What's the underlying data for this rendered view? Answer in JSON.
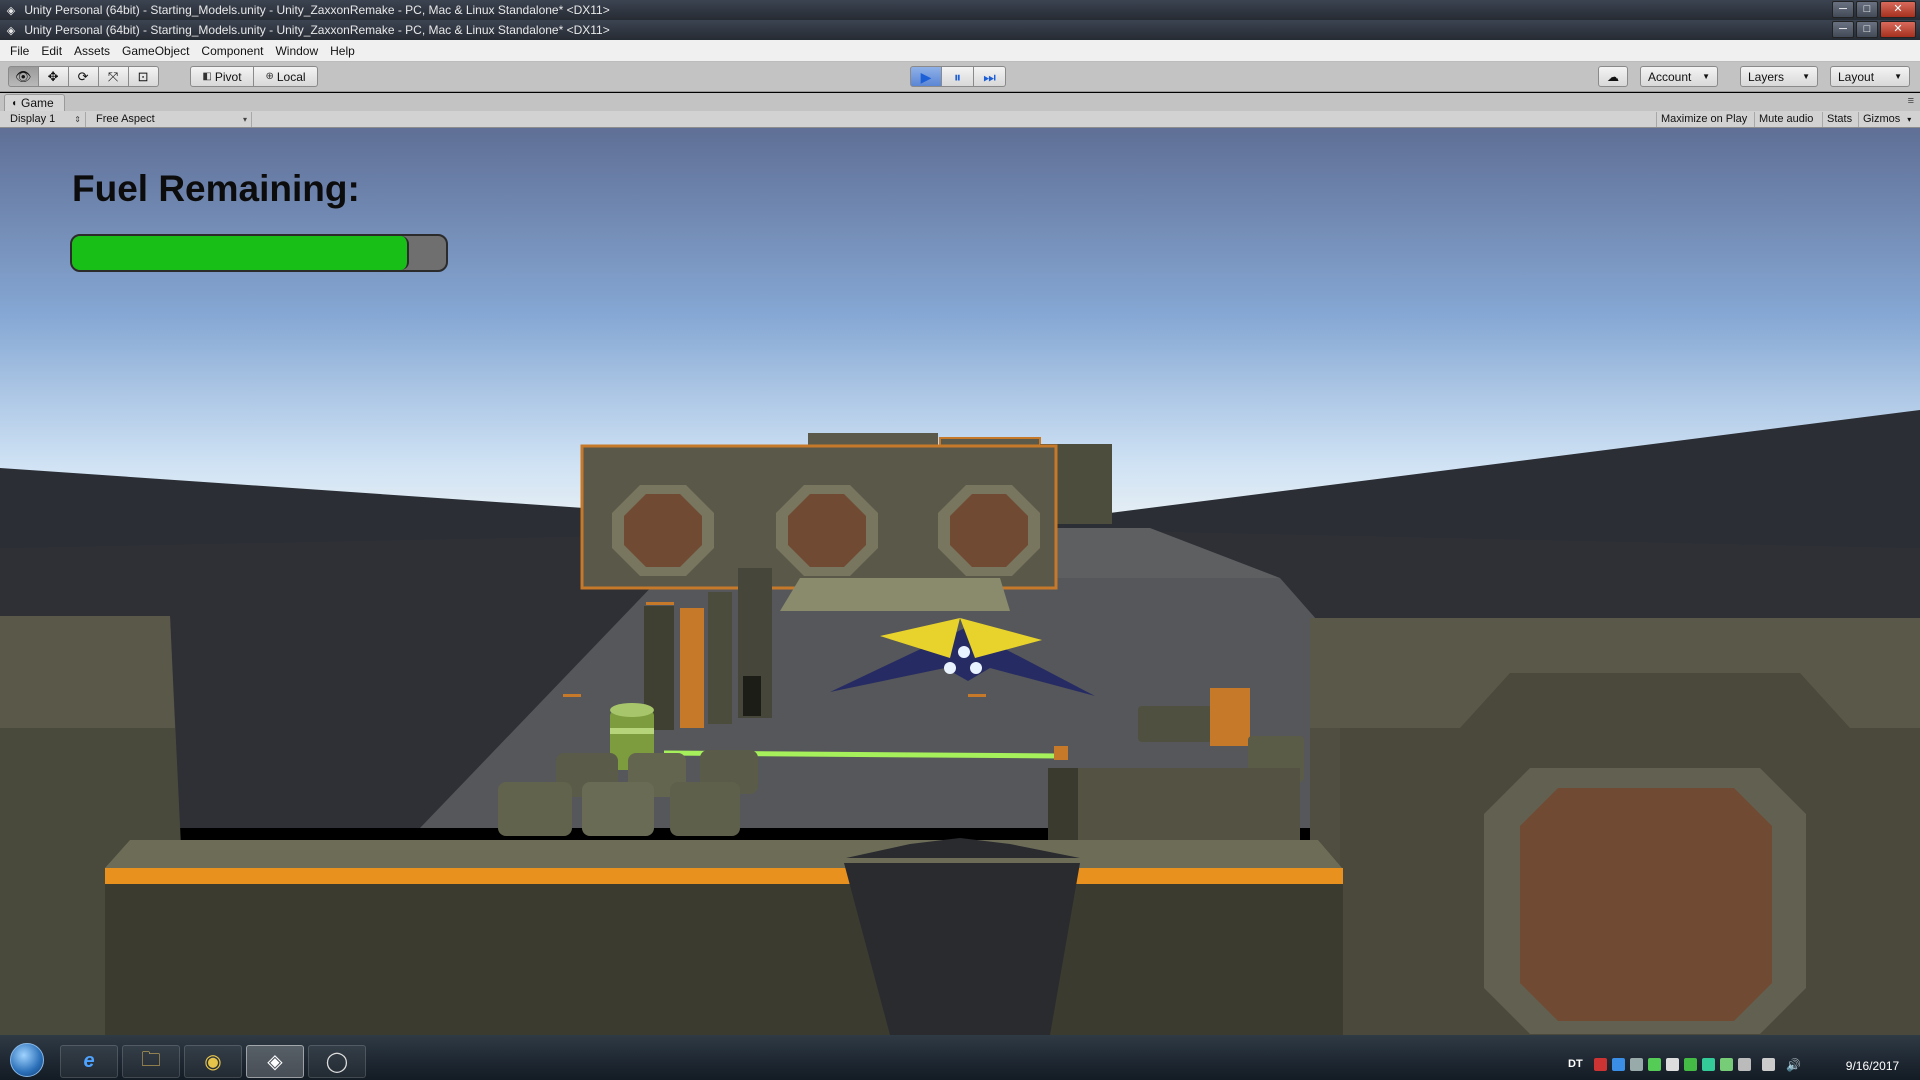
{
  "window": {
    "title_back": "Unity Personal (64bit) - Starting_Models.unity - Unity_ZaxxonRemake - PC, Mac & Linux Standalone* <DX11>",
    "title_front": "Unity Personal (64bit) - Starting_Models.unity - Unity_ZaxxonRemake - PC, Mac & Linux Standalone* <DX11>",
    "controls": {
      "minimize": "─",
      "maximize": "□",
      "close": "✕"
    }
  },
  "menu": [
    "File",
    "Edit",
    "Assets",
    "GameObject",
    "Component",
    "Window",
    "Help"
  ],
  "toolbar": {
    "tools": [
      {
        "name": "hand-tool",
        "icon": "👁"
      },
      {
        "name": "move-tool",
        "icon": "✥"
      },
      {
        "name": "rotate-tool",
        "icon": "⟳"
      },
      {
        "name": "scale-tool",
        "icon": "⤧"
      },
      {
        "name": "rect-tool",
        "icon": "⊡"
      }
    ],
    "pivot_label": "Pivot",
    "local_label": "Local",
    "play_icon": "▶",
    "pause_icon": "⏸",
    "step_icon": "⏭",
    "cloud_icon": "☁",
    "account_label": "Account",
    "layers_label": "Layers",
    "layout_label": "Layout"
  },
  "game_panel": {
    "tab_label": "Game",
    "display": "Display 1",
    "aspect": "Free Aspect",
    "maximize_on_play": "Maximize on Play",
    "mute_audio": "Mute audio",
    "stats": "Stats",
    "gizmos": "Gizmos"
  },
  "hud": {
    "fuel_label": "Fuel Remaining:",
    "fuel_level": 0.9,
    "fuel_color": "#17bf17"
  },
  "taskbar": {
    "pinned": [
      {
        "name": "internet-explorer",
        "icon": "e"
      },
      {
        "name": "file-explorer",
        "icon": "🗀"
      },
      {
        "name": "chrome",
        "icon": "◉"
      },
      {
        "name": "unity",
        "icon": "◈"
      },
      {
        "name": "other-app",
        "icon": "◯"
      }
    ],
    "tray_label": "DT",
    "date": "9/16/2017"
  }
}
